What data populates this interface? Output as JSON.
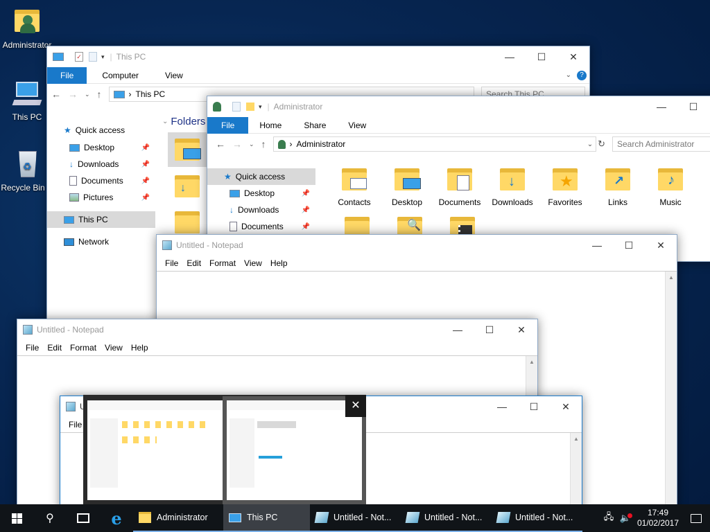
{
  "desktop": {
    "icons": [
      {
        "label": "Administrator",
        "icon": "user-folder-icon"
      },
      {
        "label": "This PC",
        "icon": "computer-icon"
      },
      {
        "label": "Recycle Bin",
        "icon": "recycle-bin-icon"
      }
    ]
  },
  "this_pc": {
    "title": "This PC",
    "tabs": [
      "File",
      "Computer",
      "View"
    ],
    "address": "This PC",
    "search_placeholder": "Search This PC",
    "nav": [
      {
        "label": "Quick access"
      },
      {
        "label": "Desktop"
      },
      {
        "label": "Downloads"
      },
      {
        "label": "Documents"
      },
      {
        "label": "Pictures"
      },
      {
        "label": "This PC"
      },
      {
        "label": "Network"
      }
    ],
    "section": "Folders"
  },
  "admin": {
    "title": "Administrator",
    "tabs": [
      "File",
      "Home",
      "Share",
      "View"
    ],
    "address": "Administrator",
    "search_placeholder": "Search Administrator",
    "nav": [
      {
        "label": "Quick access"
      },
      {
        "label": "Desktop"
      },
      {
        "label": "Downloads"
      },
      {
        "label": "Documents"
      }
    ],
    "items": [
      {
        "label": "Contacts",
        "icon": "contacts-folder-icon"
      },
      {
        "label": "Desktop",
        "icon": "desktop-folder-icon"
      },
      {
        "label": "Documents",
        "icon": "documents-folder-icon"
      },
      {
        "label": "Downloads",
        "icon": "downloads-folder-icon"
      },
      {
        "label": "Favorites",
        "icon": "favorites-folder-icon"
      },
      {
        "label": "Links",
        "icon": "links-folder-icon"
      },
      {
        "label": "Music",
        "icon": "music-folder-icon"
      }
    ]
  },
  "notepad": {
    "title": "Untitled - Notepad",
    "menu": [
      "File",
      "Edit",
      "Format",
      "View",
      "Help"
    ]
  },
  "notepad3": {
    "title_fragment": "U",
    "menu_first": "File"
  },
  "taskbar": {
    "apps": [
      {
        "label": "Administrator",
        "icon": "user-folder-icon"
      },
      {
        "label": "This PC",
        "icon": "computer-icon"
      },
      {
        "label": "Untitled - Not...",
        "icon": "notepad-icon"
      },
      {
        "label": "Untitled - Not...",
        "icon": "notepad-icon"
      },
      {
        "label": "Untitled - Not...",
        "icon": "notepad-icon"
      }
    ],
    "time": "17:49",
    "date": "01/02/2017"
  }
}
